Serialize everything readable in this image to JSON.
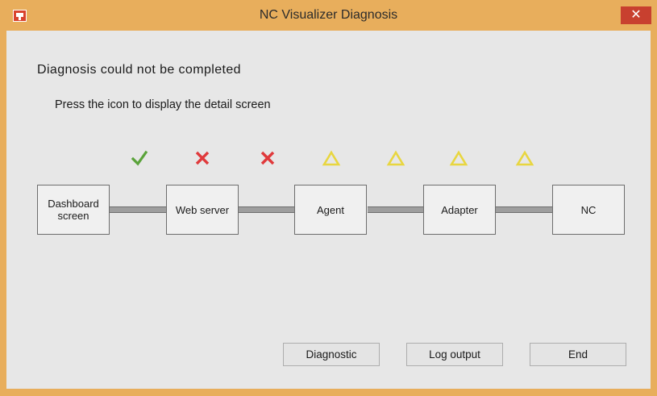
{
  "window": {
    "title": "NC Visualizer Diagnosis",
    "app_icon": "app-icon",
    "close_label": "✕"
  },
  "message": {
    "headline": "Diagnosis could not be completed",
    "instruction": "Press the icon to display the detail screen"
  },
  "statuses": [
    {
      "icon": "check-icon",
      "state": "ok",
      "color": "#5aa33a"
    },
    {
      "icon": "cross-icon",
      "state": "error",
      "color": "#e0393b"
    },
    {
      "icon": "cross-icon",
      "state": "error",
      "color": "#e0393b"
    },
    {
      "icon": "warning-triangle-icon",
      "state": "unknown",
      "color": "#e8d640"
    },
    {
      "icon": "warning-triangle-icon",
      "state": "unknown",
      "color": "#e8d640"
    },
    {
      "icon": "warning-triangle-icon",
      "state": "unknown",
      "color": "#e8d640"
    },
    {
      "icon": "warning-triangle-icon",
      "state": "unknown",
      "color": "#e8d640"
    }
  ],
  "nodes": [
    {
      "label": "Dashboard screen"
    },
    {
      "label": "Web server"
    },
    {
      "label": "Agent"
    },
    {
      "label": "Adapter"
    },
    {
      "label": "NC"
    }
  ],
  "buttons": {
    "diagnostic": "Diagnostic",
    "log_output": "Log output",
    "end": "End"
  },
  "colors": {
    "titlebar": "#e8ae5c",
    "close_button": "#c8402f",
    "client_background": "#e7e7e7"
  }
}
